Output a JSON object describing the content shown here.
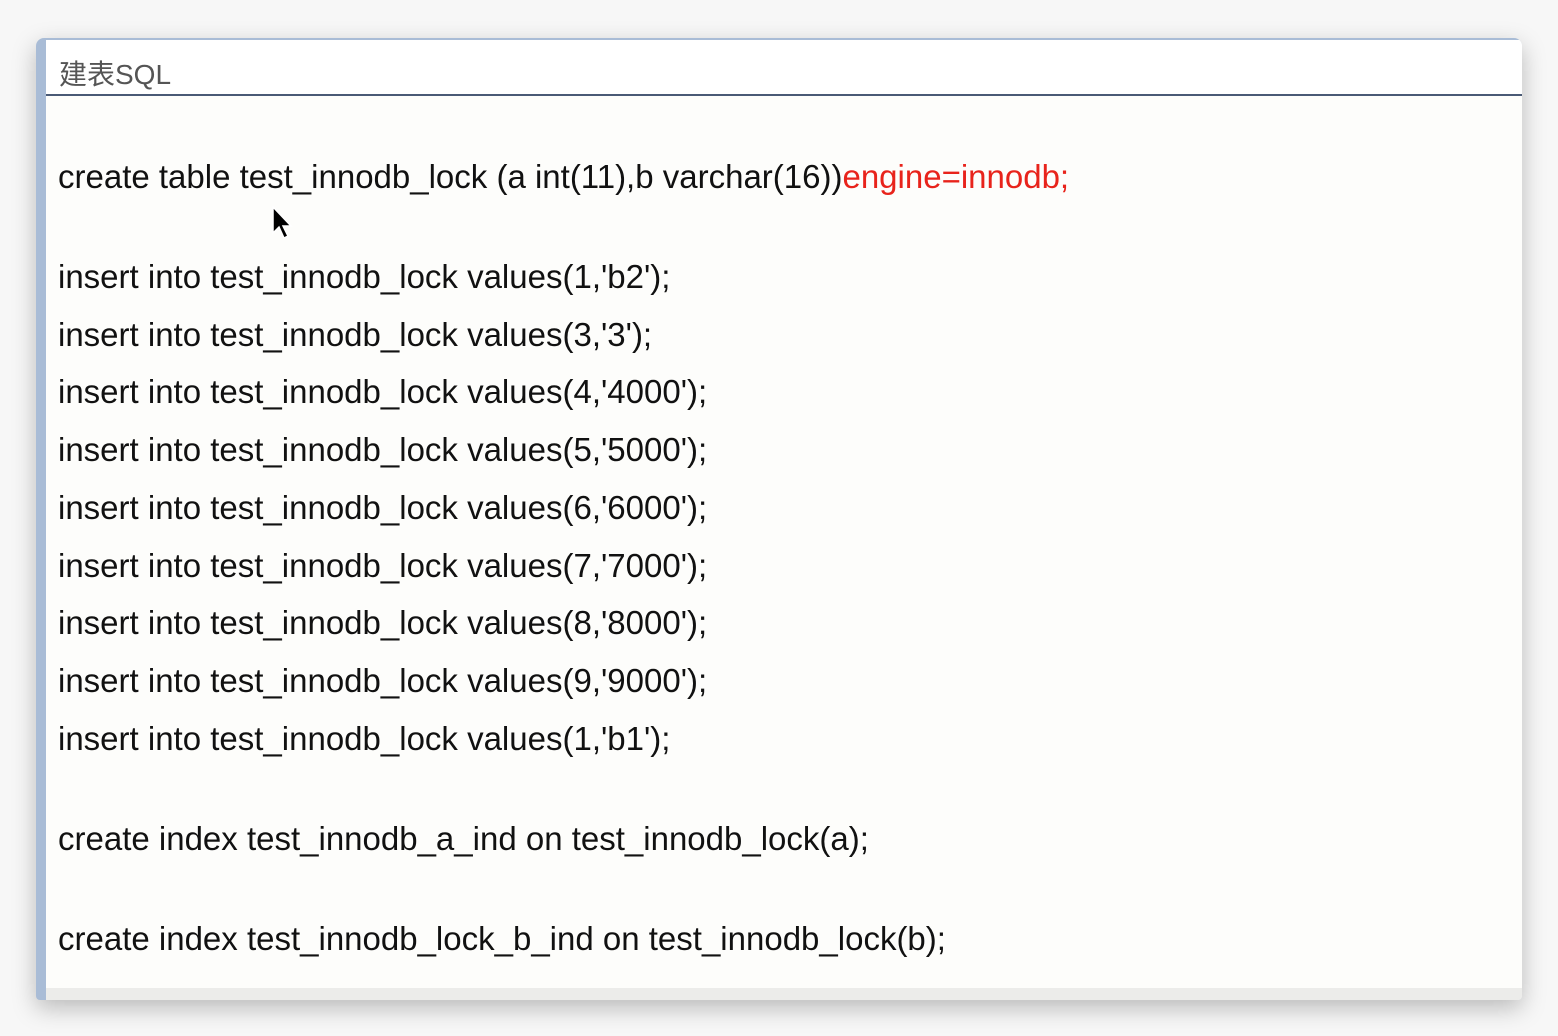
{
  "header": {
    "title": "建表SQL"
  },
  "code": {
    "create_table": "create table test_innodb_lock (a int(11),b varchar(16))",
    "create_table_engine": "engine=innodb;",
    "inserts": [
      "insert into test_innodb_lock values(1,'b2');",
      "insert into test_innodb_lock values(3,'3');",
      "insert into test_innodb_lock values(4,'4000');",
      "insert into test_innodb_lock values(5,'5000');",
      "insert into test_innodb_lock values(6,'6000');",
      "insert into test_innodb_lock values(7,'7000');",
      "insert into test_innodb_lock values(8,'8000');",
      "insert into test_innodb_lock values(9,'9000');",
      "insert into test_innodb_lock values(1,'b1');"
    ],
    "index_a": "create index test_innodb_a_ind on test_innodb_lock(a);",
    "index_b": "create index test_innodb_lock_b_ind on test_innodb_lock(b);"
  },
  "colors": {
    "keyword_highlight": "#e8231b",
    "frame": "#a9bcd6"
  }
}
